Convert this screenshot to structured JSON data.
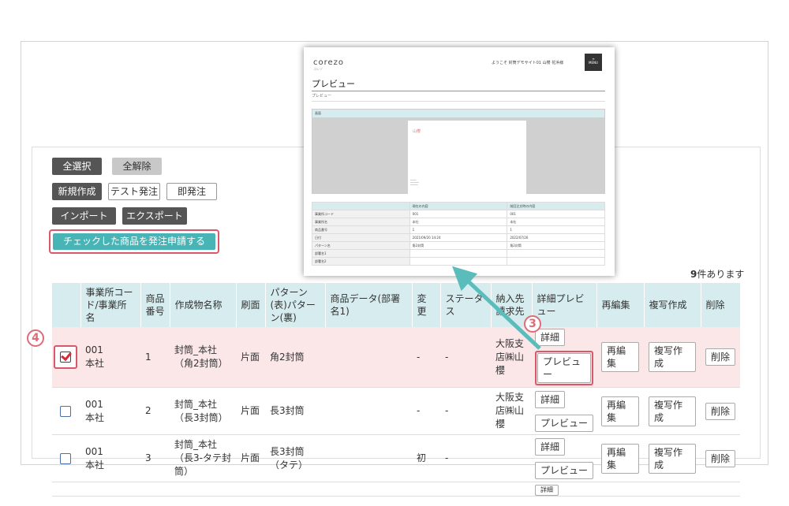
{
  "toolbar": {
    "select_all": "全選択",
    "clear_all": "全解除",
    "new": "新規作成",
    "test_order": "テスト発注",
    "instant_order": "即発注",
    "import": "インポート",
    "export": "エクスポート",
    "apply_checked": "チェックした商品を発注申請する"
  },
  "count": {
    "number": "9",
    "suffix": "件あります"
  },
  "table": {
    "headers": {
      "office": "事業所コード/事業所名",
      "item_no": "商品番号",
      "name": "作成物名称",
      "side": "刷面",
      "pattern": "パターン(表)パターン(裏)",
      "data": "商品データ(部署名1)",
      "change": "変更",
      "status": "ステータス",
      "delivery": "納入先請求先",
      "detail": "詳細プレビュー",
      "reedit": "再編集",
      "copy": "複写作成",
      "delete": "削除"
    },
    "rows": [
      {
        "code": "001",
        "office": "本社",
        "no": "1",
        "name": "封筒_本社（角2封筒）",
        "side": "片面",
        "pattern": "角2封筒",
        "change": "-",
        "status": "-",
        "delivery": "大阪支店㈱山櫻"
      },
      {
        "code": "001",
        "office": "本社",
        "no": "2",
        "name": "封筒_本社（長3封筒）",
        "side": "片面",
        "pattern": "長3封筒",
        "change": "-",
        "status": "-",
        "delivery": "大阪支店㈱山櫻"
      },
      {
        "code": "001",
        "office": "本社",
        "no": "3",
        "name": "封筒_本社（長3-タテ封筒）",
        "side": "片面",
        "pattern": "長3封筒（タテ）",
        "change": "初",
        "status": "-",
        "delivery": ""
      }
    ],
    "btn_detail": "詳細",
    "btn_preview": "プレビュー",
    "btn_reedit": "再編集",
    "btn_copy": "複写作成",
    "btn_delete": "削除",
    "partial_detail": "詳細"
  },
  "markers": {
    "step3": "3",
    "step4": "4"
  },
  "preview": {
    "logo": "corezo",
    "logo_sub": "コレゾ",
    "user": "ようこそ 封筒デモサイト01 山櫻 花浜様",
    "menu": "MENU",
    "title": "プレビュー",
    "breadcrumb": "プレビュー",
    "section": "画面",
    "page_text": "山櫻",
    "cols": [
      "",
      "現在の内容",
      "前回注文時の内容"
    ],
    "rows": [
      [
        "事業所コード",
        "001",
        "001"
      ],
      [
        "事業所名",
        "本社",
        "本社"
      ],
      [
        "商品番号",
        "1",
        "1"
      ],
      [
        "日付",
        "2021/09/20 14:24",
        "2022/07/26"
      ],
      [
        "パターン名",
        "角2封筒",
        "角2封筒"
      ],
      [
        "部署名1",
        "",
        ""
      ],
      [
        "部署名2",
        "",
        ""
      ]
    ]
  },
  "colors": {
    "teal": "#49b4b6",
    "highlight": "#d9596a",
    "arrow": "#5bbcbc"
  }
}
